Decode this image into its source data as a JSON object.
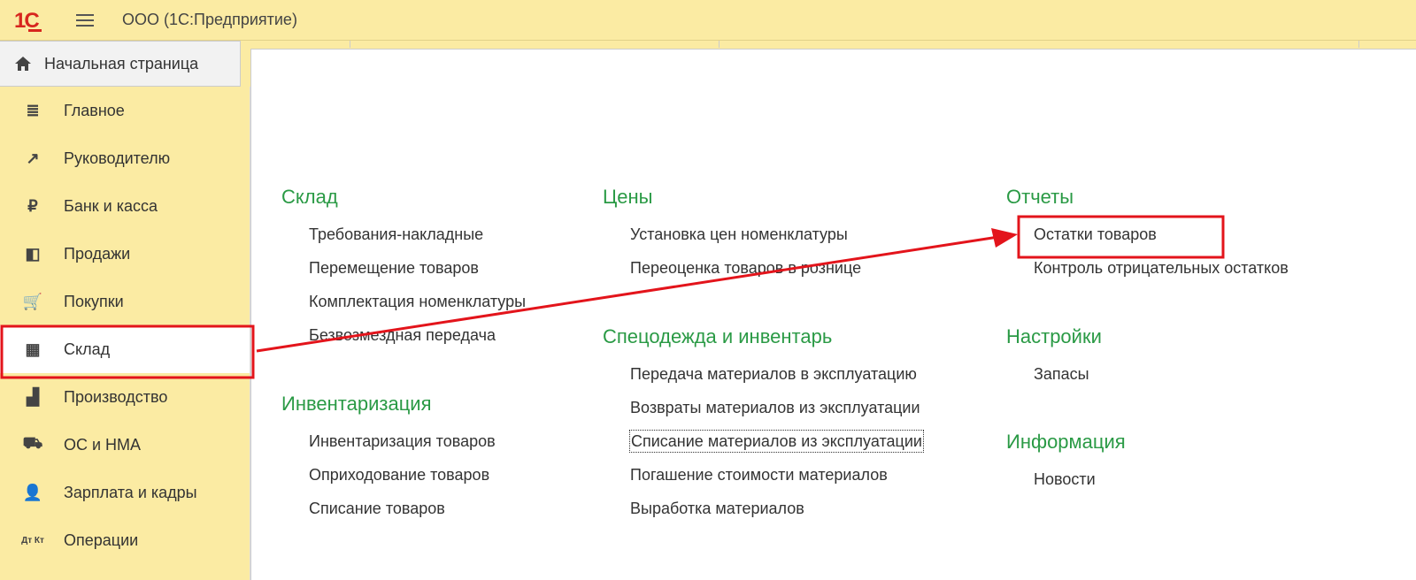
{
  "app": {
    "title": "ООО  (1С:Предприятие)",
    "logo_text": "1С"
  },
  "home_tab": "Начальная страница",
  "sidebar": {
    "items": [
      {
        "label": "Главное",
        "icon": "≣",
        "name": "list-icon"
      },
      {
        "label": "Руководителю",
        "icon": "↗",
        "name": "trend-icon"
      },
      {
        "label": "Банк и касса",
        "icon": "₽",
        "name": "ruble-icon"
      },
      {
        "label": "Продажи",
        "icon": "◧",
        "name": "shopping-bag-icon"
      },
      {
        "label": "Покупки",
        "icon": "🛒",
        "name": "cart-icon"
      },
      {
        "label": "Склад",
        "icon": "▦",
        "name": "warehouse-icon",
        "active": true
      },
      {
        "label": "Производство",
        "icon": "▟",
        "name": "factory-icon"
      },
      {
        "label": "ОС и НМА",
        "icon": "⛟",
        "name": "truck-icon"
      },
      {
        "label": "Зарплата и кадры",
        "icon": "👤",
        "name": "person-icon"
      },
      {
        "label": "Операции",
        "icon": "Дт Кт",
        "name": "debit-credit-icon"
      }
    ]
  },
  "sections": [
    {
      "id": "sklad",
      "title": "Склад",
      "links": [
        "Требования-накладные",
        "Перемещение товаров",
        "Комплектация номенклатуры",
        "Безвозмездная передача"
      ]
    },
    {
      "id": "inv",
      "title": "Инвентаризация",
      "links": [
        "Инвентаризация товаров",
        "Оприходование товаров",
        "Списание товаров"
      ]
    },
    {
      "id": "prices",
      "title": "Цены",
      "links": [
        "Установка цен номенклатуры",
        "Переоценка товаров в рознице"
      ]
    },
    {
      "id": "workwear",
      "title": "Спецодежда и инвентарь",
      "links": [
        "Передача материалов в эксплуатацию",
        "Возвраты материалов из эксплуатации",
        "Списание материалов из эксплуатации",
        "Погашение стоимости материалов",
        "Выработка материалов"
      ],
      "focused": 2
    },
    {
      "id": "reports",
      "title": "Отчеты",
      "links": [
        "Остатки товаров",
        "Контроль отрицательных остатков"
      ]
    },
    {
      "id": "settings",
      "title": "Настройки",
      "links": [
        "Запасы"
      ]
    },
    {
      "id": "info",
      "title": "Информация",
      "links": [
        "Новости"
      ]
    }
  ],
  "colors": {
    "accent": "#2a9a45",
    "highlight": "#e3141b",
    "panel": "#fbeba3"
  }
}
